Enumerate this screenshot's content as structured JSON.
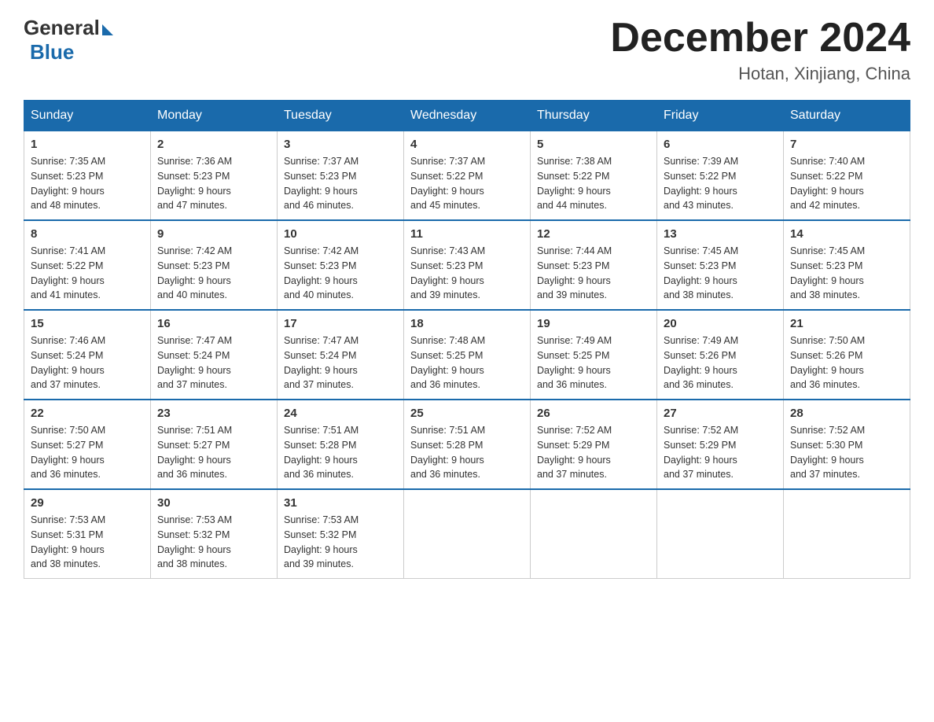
{
  "header": {
    "logo_general": "General",
    "logo_blue": "Blue",
    "month_title": "December 2024",
    "location": "Hotan, Xinjiang, China"
  },
  "days_of_week": [
    "Sunday",
    "Monday",
    "Tuesday",
    "Wednesday",
    "Thursday",
    "Friday",
    "Saturday"
  ],
  "weeks": [
    [
      {
        "day": "1",
        "sunrise": "7:35 AM",
        "sunset": "5:23 PM",
        "daylight": "9 hours and 48 minutes."
      },
      {
        "day": "2",
        "sunrise": "7:36 AM",
        "sunset": "5:23 PM",
        "daylight": "9 hours and 47 minutes."
      },
      {
        "day": "3",
        "sunrise": "7:37 AM",
        "sunset": "5:23 PM",
        "daylight": "9 hours and 46 minutes."
      },
      {
        "day": "4",
        "sunrise": "7:37 AM",
        "sunset": "5:22 PM",
        "daylight": "9 hours and 45 minutes."
      },
      {
        "day": "5",
        "sunrise": "7:38 AM",
        "sunset": "5:22 PM",
        "daylight": "9 hours and 44 minutes."
      },
      {
        "day": "6",
        "sunrise": "7:39 AM",
        "sunset": "5:22 PM",
        "daylight": "9 hours and 43 minutes."
      },
      {
        "day": "7",
        "sunrise": "7:40 AM",
        "sunset": "5:22 PM",
        "daylight": "9 hours and 42 minutes."
      }
    ],
    [
      {
        "day": "8",
        "sunrise": "7:41 AM",
        "sunset": "5:22 PM",
        "daylight": "9 hours and 41 minutes."
      },
      {
        "day": "9",
        "sunrise": "7:42 AM",
        "sunset": "5:23 PM",
        "daylight": "9 hours and 40 minutes."
      },
      {
        "day": "10",
        "sunrise": "7:42 AM",
        "sunset": "5:23 PM",
        "daylight": "9 hours and 40 minutes."
      },
      {
        "day": "11",
        "sunrise": "7:43 AM",
        "sunset": "5:23 PM",
        "daylight": "9 hours and 39 minutes."
      },
      {
        "day": "12",
        "sunrise": "7:44 AM",
        "sunset": "5:23 PM",
        "daylight": "9 hours and 39 minutes."
      },
      {
        "day": "13",
        "sunrise": "7:45 AM",
        "sunset": "5:23 PM",
        "daylight": "9 hours and 38 minutes."
      },
      {
        "day": "14",
        "sunrise": "7:45 AM",
        "sunset": "5:23 PM",
        "daylight": "9 hours and 38 minutes."
      }
    ],
    [
      {
        "day": "15",
        "sunrise": "7:46 AM",
        "sunset": "5:24 PM",
        "daylight": "9 hours and 37 minutes."
      },
      {
        "day": "16",
        "sunrise": "7:47 AM",
        "sunset": "5:24 PM",
        "daylight": "9 hours and 37 minutes."
      },
      {
        "day": "17",
        "sunrise": "7:47 AM",
        "sunset": "5:24 PM",
        "daylight": "9 hours and 37 minutes."
      },
      {
        "day": "18",
        "sunrise": "7:48 AM",
        "sunset": "5:25 PM",
        "daylight": "9 hours and 36 minutes."
      },
      {
        "day": "19",
        "sunrise": "7:49 AM",
        "sunset": "5:25 PM",
        "daylight": "9 hours and 36 minutes."
      },
      {
        "day": "20",
        "sunrise": "7:49 AM",
        "sunset": "5:26 PM",
        "daylight": "9 hours and 36 minutes."
      },
      {
        "day": "21",
        "sunrise": "7:50 AM",
        "sunset": "5:26 PM",
        "daylight": "9 hours and 36 minutes."
      }
    ],
    [
      {
        "day": "22",
        "sunrise": "7:50 AM",
        "sunset": "5:27 PM",
        "daylight": "9 hours and 36 minutes."
      },
      {
        "day": "23",
        "sunrise": "7:51 AM",
        "sunset": "5:27 PM",
        "daylight": "9 hours and 36 minutes."
      },
      {
        "day": "24",
        "sunrise": "7:51 AM",
        "sunset": "5:28 PM",
        "daylight": "9 hours and 36 minutes."
      },
      {
        "day": "25",
        "sunrise": "7:51 AM",
        "sunset": "5:28 PM",
        "daylight": "9 hours and 36 minutes."
      },
      {
        "day": "26",
        "sunrise": "7:52 AM",
        "sunset": "5:29 PM",
        "daylight": "9 hours and 37 minutes."
      },
      {
        "day": "27",
        "sunrise": "7:52 AM",
        "sunset": "5:29 PM",
        "daylight": "9 hours and 37 minutes."
      },
      {
        "day": "28",
        "sunrise": "7:52 AM",
        "sunset": "5:30 PM",
        "daylight": "9 hours and 37 minutes."
      }
    ],
    [
      {
        "day": "29",
        "sunrise": "7:53 AM",
        "sunset": "5:31 PM",
        "daylight": "9 hours and 38 minutes."
      },
      {
        "day": "30",
        "sunrise": "7:53 AM",
        "sunset": "5:32 PM",
        "daylight": "9 hours and 38 minutes."
      },
      {
        "day": "31",
        "sunrise": "7:53 AM",
        "sunset": "5:32 PM",
        "daylight": "9 hours and 39 minutes."
      },
      null,
      null,
      null,
      null
    ]
  ]
}
